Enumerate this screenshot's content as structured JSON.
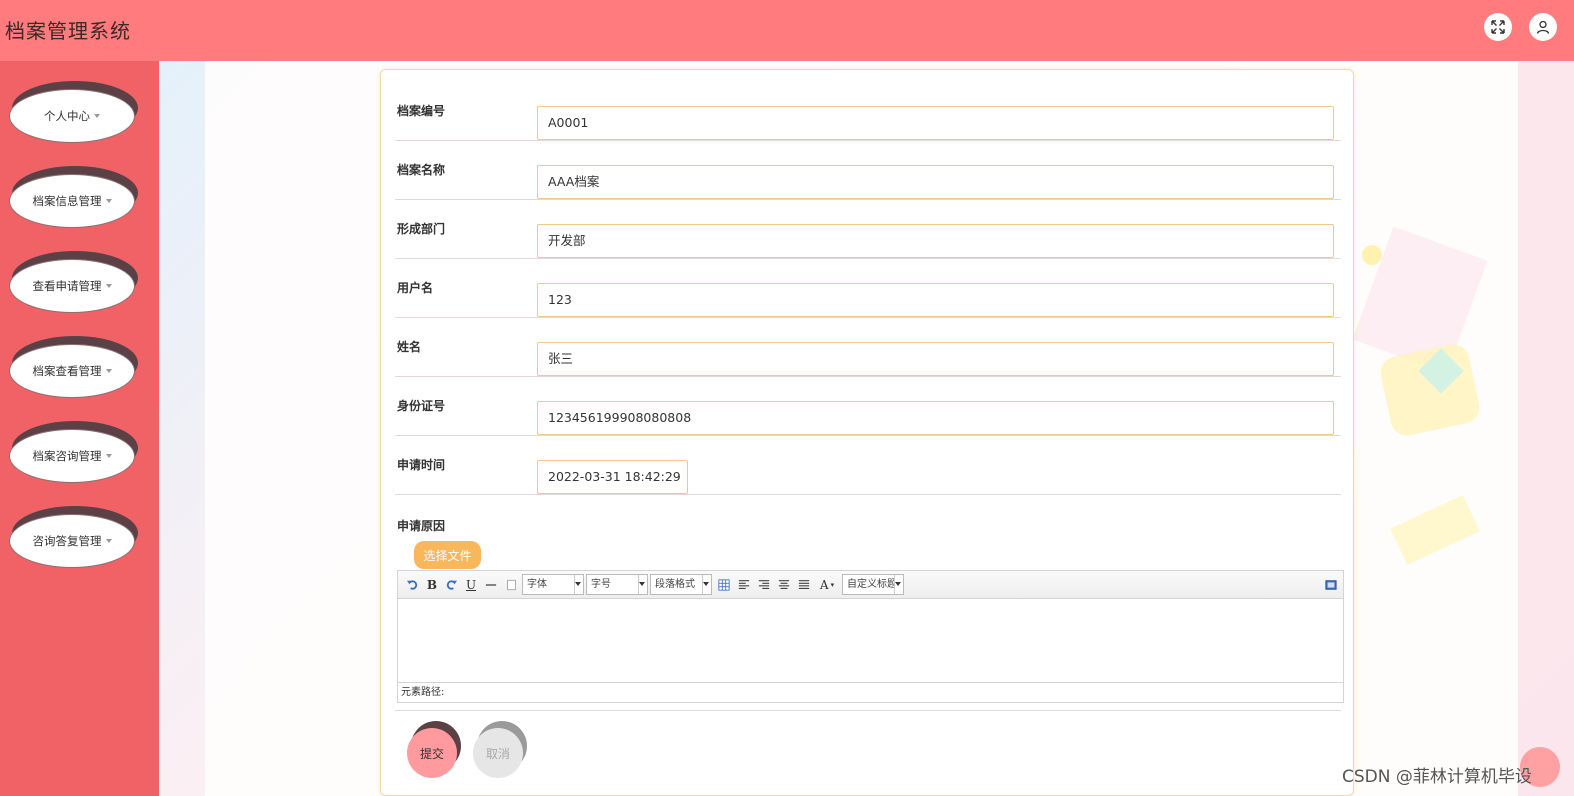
{
  "header": {
    "title": "档案管理系统",
    "fullscreen_icon": "fullscreen-icon",
    "user_icon": "user-icon",
    "color": "#ff7b7d"
  },
  "sidebar": {
    "color": "#f06265",
    "items": [
      {
        "label": "个人中心"
      },
      {
        "label": "档案信息管理"
      },
      {
        "label": "查看申请管理"
      },
      {
        "label": "档案查看管理"
      },
      {
        "label": "档案咨询管理"
      },
      {
        "label": "咨询答复管理"
      }
    ]
  },
  "form": {
    "fields": [
      {
        "label": "档案编号",
        "value": "A0001"
      },
      {
        "label": "档案名称",
        "value": "AAA档案"
      },
      {
        "label": "形成部门",
        "value": "开发部"
      },
      {
        "label": "用户名",
        "value": "123"
      },
      {
        "label": "姓名",
        "value": "张三"
      },
      {
        "label": "身份证号",
        "value": "123456199908080808"
      },
      {
        "label": "申请时间",
        "value": "2022-03-31 18:42:29"
      }
    ],
    "reason_label": "申请原因",
    "file_button": "选择文件",
    "submit_label": "提交",
    "cancel_label": "取消"
  },
  "editor": {
    "toolbar": {
      "font_select": "字体",
      "size_select": "字号",
      "paragraph_select": "段落格式",
      "custom_title_select": "自定义标题",
      "bold": "B",
      "underline": "U",
      "font_color": "A"
    },
    "element_path": "元素路径:"
  },
  "watermark": "CSDN @菲林计算机毕设"
}
